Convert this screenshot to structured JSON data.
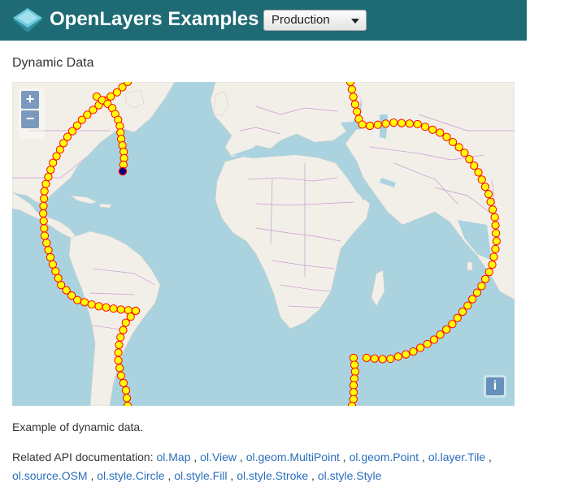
{
  "header": {
    "brand": "OpenLayers Examples",
    "version_select": "Production",
    "colors": {
      "navbar": "#1f6b75",
      "logo": "#4eb5c8"
    }
  },
  "page": {
    "title": "Dynamic Data",
    "description": "Example of dynamic data.",
    "api_label": "Related API documentation:",
    "api_links": [
      "ol.Map",
      "ol.View",
      "ol.geom.MultiPoint",
      "ol.geom.Point",
      "ol.layer.Tile",
      "ol.source.OSM",
      "ol.style.Circle",
      "ol.style.Fill",
      "ol.style.Stroke",
      "ol.style.Style"
    ]
  },
  "map": {
    "zoom_in": "+",
    "zoom_out": "−",
    "attribution": "i",
    "colors": {
      "water": "#aad3df",
      "land": "#f2efe9",
      "border": "#c89ad0",
      "point_fill": "#ffff00",
      "point_stroke": "#ff0000",
      "head_fill": "#000080"
    }
  }
}
